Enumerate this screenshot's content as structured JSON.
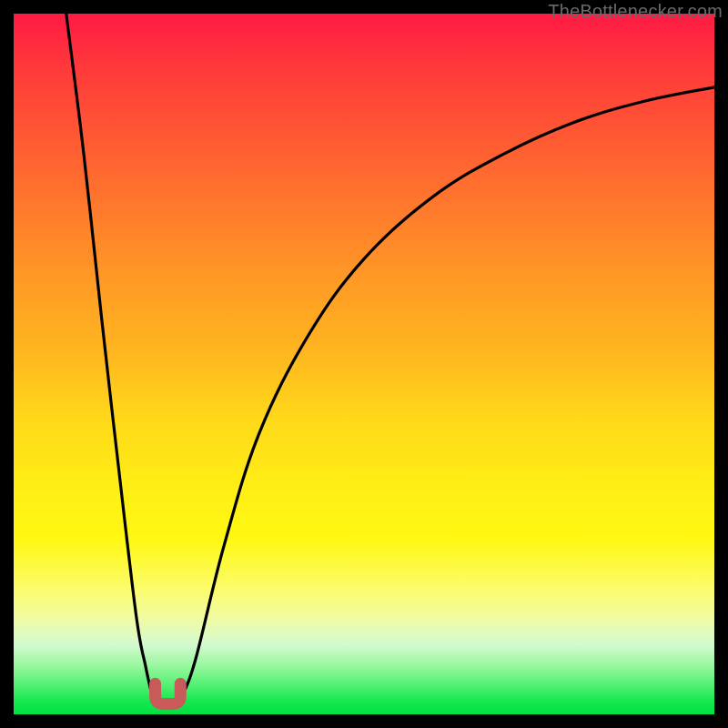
{
  "watermark": "TheBottlenecker.com",
  "colors": {
    "page_bg": "#000000",
    "curve": "#000000",
    "marker": "#c95a5a",
    "watermark_text": "#6a6a6a"
  },
  "chart_data": {
    "type": "line",
    "title": "",
    "xlabel": "",
    "ylabel": "",
    "xlim": [
      0,
      100
    ],
    "ylim": [
      0,
      100
    ],
    "grid": false,
    "legend": false,
    "series": [
      {
        "name": "left-branch",
        "x": [
          7.5,
          10,
          12.5,
          15,
          17.5,
          18.8,
          19.7,
          20.3,
          20.8
        ],
        "y": [
          100,
          80,
          57,
          35,
          14,
          7,
          3,
          1.5,
          1.0
        ]
      },
      {
        "name": "right-branch",
        "x": [
          23.2,
          24,
          26,
          30,
          35,
          42,
          50,
          60,
          70,
          80,
          90,
          100
        ],
        "y": [
          1.0,
          2.5,
          8,
          24,
          40,
          54,
          65,
          74,
          80,
          84.5,
          87.5,
          89.5
        ]
      }
    ],
    "annotations": [
      {
        "name": "u-marker",
        "shape": "U",
        "cx": 22.0,
        "cy": 2.6,
        "width": 3.6,
        "height": 3.2,
        "color": "#c95a5a"
      }
    ]
  }
}
